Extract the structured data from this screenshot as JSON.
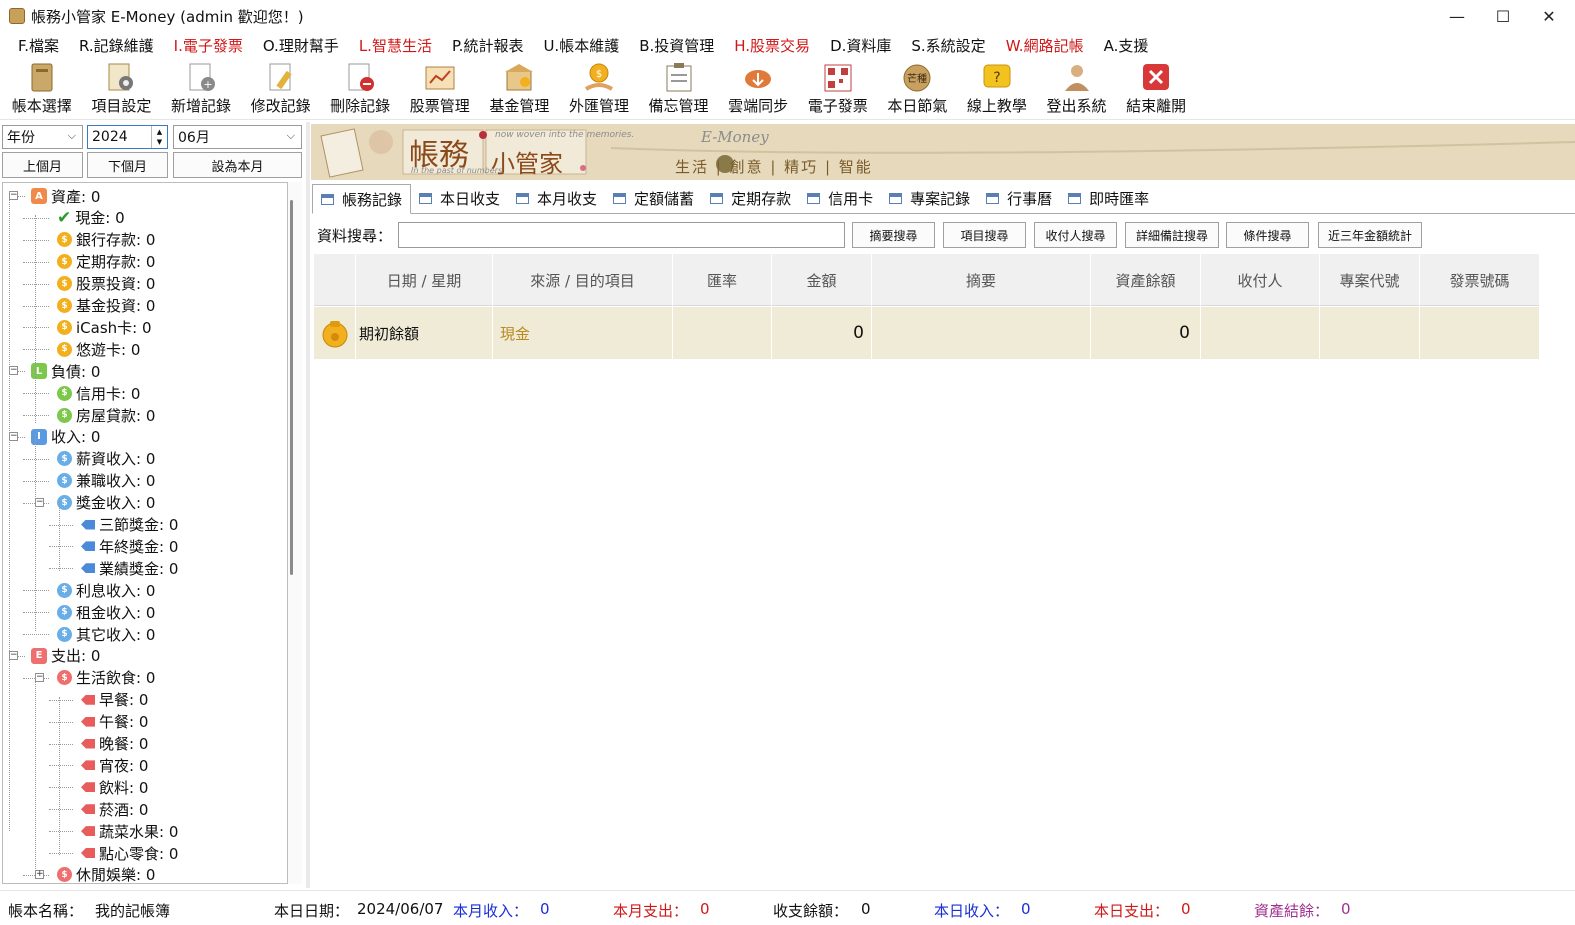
{
  "window": {
    "title": "帳務小管家 E-Money (admin 歡迎您！)",
    "minimize": "—",
    "maximize": "☐",
    "close": "✕"
  },
  "menu": [
    {
      "label": "F.檔案",
      "red": false
    },
    {
      "label": "R.記錄維護",
      "red": false
    },
    {
      "label": "I.電子發票",
      "red": true
    },
    {
      "label": "O.理財幫手",
      "red": false
    },
    {
      "label": "L.智慧生活",
      "red": true
    },
    {
      "label": "P.統計報表",
      "red": false
    },
    {
      "label": "U.帳本維護",
      "red": false
    },
    {
      "label": "B.投資管理",
      "red": false
    },
    {
      "label": "H.股票交易",
      "red": true
    },
    {
      "label": "D.資料庫",
      "red": false
    },
    {
      "label": "S.系統設定",
      "red": false
    },
    {
      "label": "W.網路記帳",
      "red": true
    },
    {
      "label": "A.支援",
      "red": false
    }
  ],
  "toolbar": [
    {
      "label": "帳本選擇",
      "icon": "ledger-book-icon"
    },
    {
      "label": "項目設定",
      "icon": "settings-doc-icon"
    },
    {
      "label": "新增記錄",
      "icon": "add-record-icon"
    },
    {
      "label": "修改記錄",
      "icon": "edit-record-icon"
    },
    {
      "label": "刪除記錄",
      "icon": "delete-record-icon"
    },
    {
      "label": "股票管理",
      "icon": "stock-icon"
    },
    {
      "label": "基金管理",
      "icon": "fund-icon"
    },
    {
      "label": "外匯管理",
      "icon": "forex-icon"
    },
    {
      "label": "備忘管理",
      "icon": "memo-icon"
    },
    {
      "label": "雲端同步",
      "icon": "cloud-sync-icon"
    },
    {
      "label": "電子發票",
      "icon": "qr-code-icon"
    },
    {
      "label": "本日節氣",
      "icon": "solar-term-icon"
    },
    {
      "label": "線上教學",
      "icon": "help-icon"
    },
    {
      "label": "登出系統",
      "icon": "logout-user-icon"
    },
    {
      "label": "結束離開",
      "icon": "exit-icon"
    }
  ],
  "filters": {
    "period_type": "年份",
    "year": "2024",
    "month": "06月",
    "prev_month": "上個月",
    "next_month": "下個月",
    "set_current": "設為本月"
  },
  "tree": [
    {
      "label": "資產: 0",
      "level": 0,
      "kind": "cat",
      "badge": "A",
      "color": "#f08a4b",
      "exp": "−"
    },
    {
      "label": "現金: 0",
      "level": 1,
      "kind": "check",
      "color": "#2a9a2a"
    },
    {
      "label": "銀行存款: 0",
      "level": 1,
      "kind": "coin",
      "color": "#f2b01e"
    },
    {
      "label": "定期存款: 0",
      "level": 1,
      "kind": "coin",
      "color": "#f2b01e"
    },
    {
      "label": "股票投資: 0",
      "level": 1,
      "kind": "coin",
      "color": "#f2b01e"
    },
    {
      "label": "基金投資: 0",
      "level": 1,
      "kind": "coin",
      "color": "#f2b01e"
    },
    {
      "label": "iCash卡: 0",
      "level": 1,
      "kind": "coin",
      "color": "#f2b01e"
    },
    {
      "label": "悠遊卡: 0",
      "level": 1,
      "kind": "coin",
      "color": "#f2b01e"
    },
    {
      "label": "負債: 0",
      "level": 0,
      "kind": "cat",
      "badge": "L",
      "color": "#7cc84a",
      "exp": "−"
    },
    {
      "label": "信用卡: 0",
      "level": 1,
      "kind": "coin",
      "color": "#7cc84a"
    },
    {
      "label": "房屋貸款: 0",
      "level": 1,
      "kind": "coin",
      "color": "#7cc84a"
    },
    {
      "label": "收入: 0",
      "level": 0,
      "kind": "cat",
      "badge": "I",
      "color": "#5a9ae0",
      "exp": "−"
    },
    {
      "label": "薪資收入: 0",
      "level": 1,
      "kind": "coin",
      "color": "#6aaee8"
    },
    {
      "label": "兼職收入: 0",
      "level": 1,
      "kind": "coin",
      "color": "#6aaee8"
    },
    {
      "label": "獎金收入: 0",
      "level": 1,
      "kind": "coin",
      "color": "#6aaee8",
      "exp": "−"
    },
    {
      "label": "三節獎金: 0",
      "level": 2,
      "kind": "tag",
      "color": "#4a8ad8"
    },
    {
      "label": "年終獎金: 0",
      "level": 2,
      "kind": "tag",
      "color": "#4a8ad8"
    },
    {
      "label": "業績獎金: 0",
      "level": 2,
      "kind": "tag",
      "color": "#4a8ad8"
    },
    {
      "label": "利息收入: 0",
      "level": 1,
      "kind": "coin",
      "color": "#6aaee8"
    },
    {
      "label": "租金收入: 0",
      "level": 1,
      "kind": "coin",
      "color": "#6aaee8"
    },
    {
      "label": "其它收入: 0",
      "level": 1,
      "kind": "coin",
      "color": "#6aaee8"
    },
    {
      "label": "支出: 0",
      "level": 0,
      "kind": "cat",
      "badge": "E",
      "color": "#ef6f6f",
      "exp": "−"
    },
    {
      "label": "生活飲食: 0",
      "level": 1,
      "kind": "coin",
      "color": "#ef6f6f",
      "exp": "−"
    },
    {
      "label": "早餐: 0",
      "level": 2,
      "kind": "tag",
      "color": "#e85c5c"
    },
    {
      "label": "午餐: 0",
      "level": 2,
      "kind": "tag",
      "color": "#e85c5c"
    },
    {
      "label": "晚餐: 0",
      "level": 2,
      "kind": "tag",
      "color": "#e85c5c"
    },
    {
      "label": "宵夜: 0",
      "level": 2,
      "kind": "tag",
      "color": "#e85c5c"
    },
    {
      "label": "飲料: 0",
      "level": 2,
      "kind": "tag",
      "color": "#e85c5c"
    },
    {
      "label": "菸酒: 0",
      "level": 2,
      "kind": "tag",
      "color": "#e85c5c"
    },
    {
      "label": "蔬菜水果: 0",
      "level": 2,
      "kind": "tag",
      "color": "#e85c5c"
    },
    {
      "label": "點心零食: 0",
      "level": 2,
      "kind": "tag",
      "color": "#e85c5c"
    },
    {
      "label": "休閒娛樂: 0",
      "level": 1,
      "kind": "coin",
      "color": "#ef6f6f",
      "exp": "+"
    }
  ],
  "banner": {
    "title1": "帳務",
    "title2": "小管家",
    "emoney": "E-Money",
    "tag_top": "now woven into the memories.",
    "tag_bottom": "In the past of numbers.",
    "slogan": "生活 | 創意 | 精巧 | 智能"
  },
  "tabs": [
    {
      "label": "帳務記錄",
      "active": true
    },
    {
      "label": "本日收支",
      "active": false
    },
    {
      "label": "本月收支",
      "active": false
    },
    {
      "label": "定額儲蓄",
      "active": false
    },
    {
      "label": "定期存款",
      "active": false
    },
    {
      "label": "信用卡",
      "active": false
    },
    {
      "label": "專案記錄",
      "active": false
    },
    {
      "label": "行事曆",
      "active": false
    },
    {
      "label": "即時匯率",
      "active": false
    }
  ],
  "search": {
    "label": "資料搜尋：",
    "value": "",
    "buttons": [
      "摘要搜尋",
      "項目搜尋",
      "收付人搜尋",
      "詳細備註搜尋",
      "條件搜尋",
      "近三年金額統計"
    ]
  },
  "grid": {
    "columns": [
      "",
      "日期 / 星期",
      "來源 / 目的項目",
      "匯率",
      "金額",
      "摘要",
      "資產餘額",
      "收付人",
      "專案代號",
      "發票號碼"
    ],
    "rows": [
      {
        "date": "期初餘額",
        "item": "現金",
        "rate": "",
        "amount": "0",
        "summary": "",
        "balance": "0",
        "payee": "",
        "project": "",
        "invoice": ""
      }
    ]
  },
  "status": {
    "book_label": "帳本名稱：",
    "book_value": "我的記帳簿",
    "date_label": "本日日期：",
    "date_value": "2024/06/07",
    "month_income_label": "本月收入：",
    "month_income_value": "0",
    "month_expense_label": "本月支出：",
    "month_expense_value": "0",
    "net_label": "收支餘額：",
    "net_value": "0",
    "day_income_label": "本日收入：",
    "day_income_value": "0",
    "day_expense_label": "本日支出：",
    "day_expense_value": "0",
    "asset_label": "資產結餘：",
    "asset_value": "0"
  },
  "colors": {
    "menu_red": "#d01818",
    "income_blue": "#1a2ed8",
    "expense_red": "#d01818",
    "asset_purple": "#a03090",
    "row_bg": "#efebd6",
    "item_gold": "#b98a1e"
  }
}
